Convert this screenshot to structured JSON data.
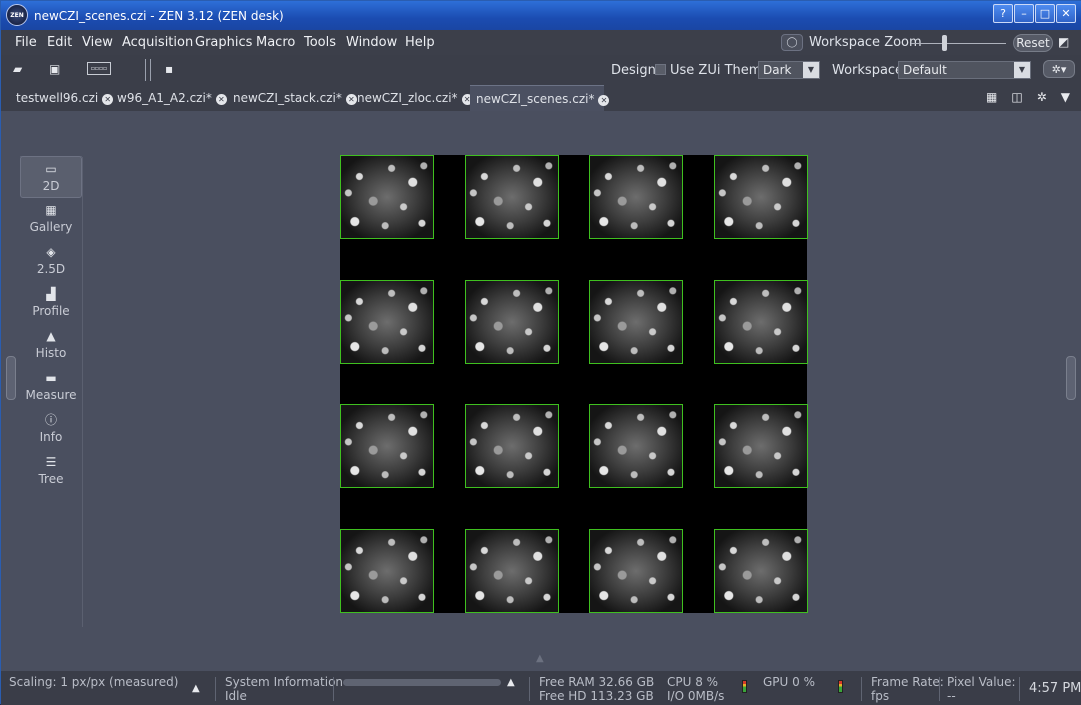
{
  "window": {
    "title": "newCZI_scenes.czi - ZEN 3.12 (ZEN desk)",
    "logo_text": "ZEN",
    "buttons": {
      "help": "?",
      "minimize": "–",
      "maximize": "□",
      "close": "✕"
    }
  },
  "menubar": {
    "items": [
      "File",
      "Edit",
      "View",
      "Acquisition",
      "Graphics",
      "Macro",
      "Tools",
      "Window",
      "Help"
    ],
    "workspace_zoom_label": "Workspace Zoom",
    "reset_label": "Reset"
  },
  "toolbar": {
    "design_label": "Design",
    "zui_theme_label": "Use ZUi Theme",
    "zui_checked": false,
    "theme_value": "Dark",
    "workspace_label": "Workspace",
    "workspace_value": "Default"
  },
  "tabs": [
    {
      "label": "testwell96.czi",
      "active": false
    },
    {
      "label": "w96_A1_A2.czi*",
      "active": false
    },
    {
      "label": "newCZI_stack.czi*",
      "active": false
    },
    {
      "label": "newCZI_zloc.czi*",
      "active": false
    },
    {
      "label": "newCZI_scenes.czi*",
      "active": true
    }
  ],
  "view_tools": [
    {
      "label": "2D",
      "icon": "2d-view-icon",
      "active": true
    },
    {
      "label": "Gallery",
      "icon": "gallery-icon",
      "active": false
    },
    {
      "label": "2.5D",
      "icon": "2-5d-icon",
      "active": false
    },
    {
      "label": "Profile",
      "icon": "profile-icon",
      "active": false
    },
    {
      "label": "Histo",
      "icon": "histogram-icon",
      "active": false
    },
    {
      "label": "Measure",
      "icon": "measure-icon",
      "active": false
    },
    {
      "label": "Info",
      "icon": "info-icon",
      "active": false
    },
    {
      "label": "Tree",
      "icon": "tree-icon",
      "active": false
    }
  ],
  "scenes": {
    "rows": 4,
    "cols": 4,
    "border_color": "#3fc01f"
  },
  "statusbar": {
    "scaling": "Scaling:  1 px/px (measured)",
    "system_info_label": "System Information",
    "system_status": "Idle",
    "free_ram": "Free RAM 32.66 GB",
    "free_hd": "Free HD   113.23 GB",
    "cpu": "CPU 8 %",
    "io": "I/O   0MB/s",
    "gpu": "GPU 0 %",
    "frame_rate_label": "Frame Rate:",
    "frame_rate_value": "fps",
    "pixel_value_label": "Pixel Value:",
    "pixel_value": "--",
    "clock": "4:57 PM"
  },
  "colors": {
    "accent": "#2e6fd8",
    "panel": "#4a4f5f",
    "scene_border": "#3fc01f"
  }
}
